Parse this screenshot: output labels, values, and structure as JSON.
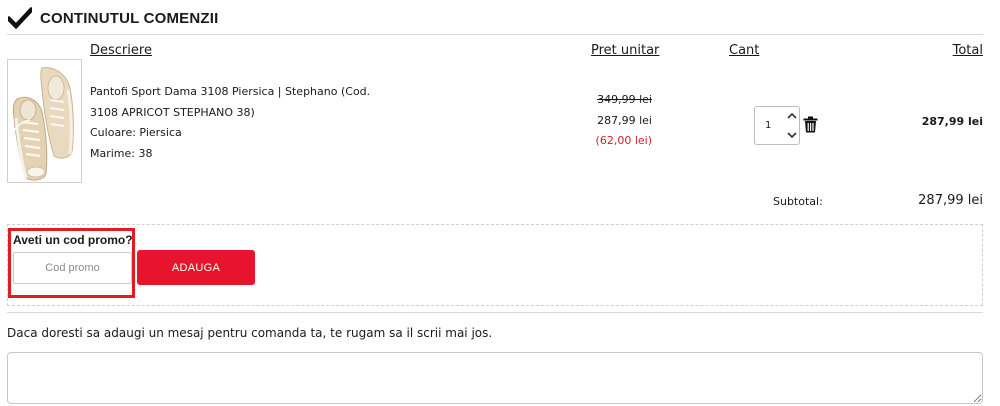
{
  "section": {
    "title": "CONTINUTUL COMENZII",
    "icon": "checkmark-icon"
  },
  "columns": {
    "description": "Descriere",
    "unit_price": "Pret unitar",
    "quantity": "Cant",
    "total": "Total"
  },
  "product": {
    "name": "Pantofi Sport Dama 3108 Piersica | Stephano (Cod. 3108 APRICOT STEPHANO 38)",
    "color": "Culoare: Piersica",
    "size": "Marime: 38",
    "price_old": "349,99 lei",
    "price_now": "287,99 lei",
    "discount": "(62,00 lei)",
    "quantity": "1",
    "line_total": "287,99 lei"
  },
  "subtotal": {
    "label": "Subtotal:",
    "value": "287,99 lei"
  },
  "promo": {
    "label": "Aveti un cod promo?",
    "placeholder": "Cod promo",
    "button": "ADAUGA"
  },
  "message": {
    "prompt": "Daca doresti sa adaugi un mesaj pentru comanda ta, te rugam sa il scrii mai jos."
  },
  "colors": {
    "accent": "#e8132c",
    "highlight_border": "#e21b24",
    "discount": "#d21f2b"
  }
}
